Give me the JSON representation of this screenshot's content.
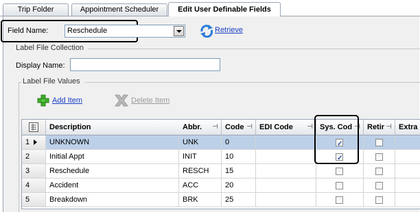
{
  "tabs": [
    {
      "label": "Trip Folder"
    },
    {
      "label": "Appointment Scheduler"
    },
    {
      "label": "Edit User Definable Fields"
    }
  ],
  "field_name": {
    "label": "Field Name:",
    "value": "Reschedule"
  },
  "retrieve": {
    "label": "Retrieve"
  },
  "label_file_collection": {
    "title": "Label File Collection",
    "display_name_label": "Display Name:",
    "display_name_value": ""
  },
  "label_file_values": {
    "title": "Label File Values",
    "add_item": "Add Item",
    "delete_item": "Delete Item"
  },
  "grid": {
    "columns": [
      "Description",
      "Abbr.",
      "Code",
      "EDI Code",
      "Sys. Cod",
      "Retir",
      "Extra"
    ],
    "rows": [
      {
        "num": "1",
        "description": "UNKNOWN",
        "abbr": "UNK",
        "code": "0",
        "edi": "",
        "sys": true,
        "retired": false
      },
      {
        "num": "2",
        "description": "Initial Appt",
        "abbr": "INIT",
        "code": "10",
        "edi": "",
        "sys": true,
        "retired": false
      },
      {
        "num": "3",
        "description": "Reschedule",
        "abbr": "RESCH",
        "code": "15",
        "edi": "",
        "sys": false,
        "retired": false
      },
      {
        "num": "4",
        "description": "Accident",
        "abbr": "ACC",
        "code": "20",
        "edi": "",
        "sys": false,
        "retired": false
      },
      {
        "num": "5",
        "description": "Breakdown",
        "abbr": "BRK",
        "code": "25",
        "edi": "",
        "sys": false,
        "retired": false
      }
    ]
  }
}
